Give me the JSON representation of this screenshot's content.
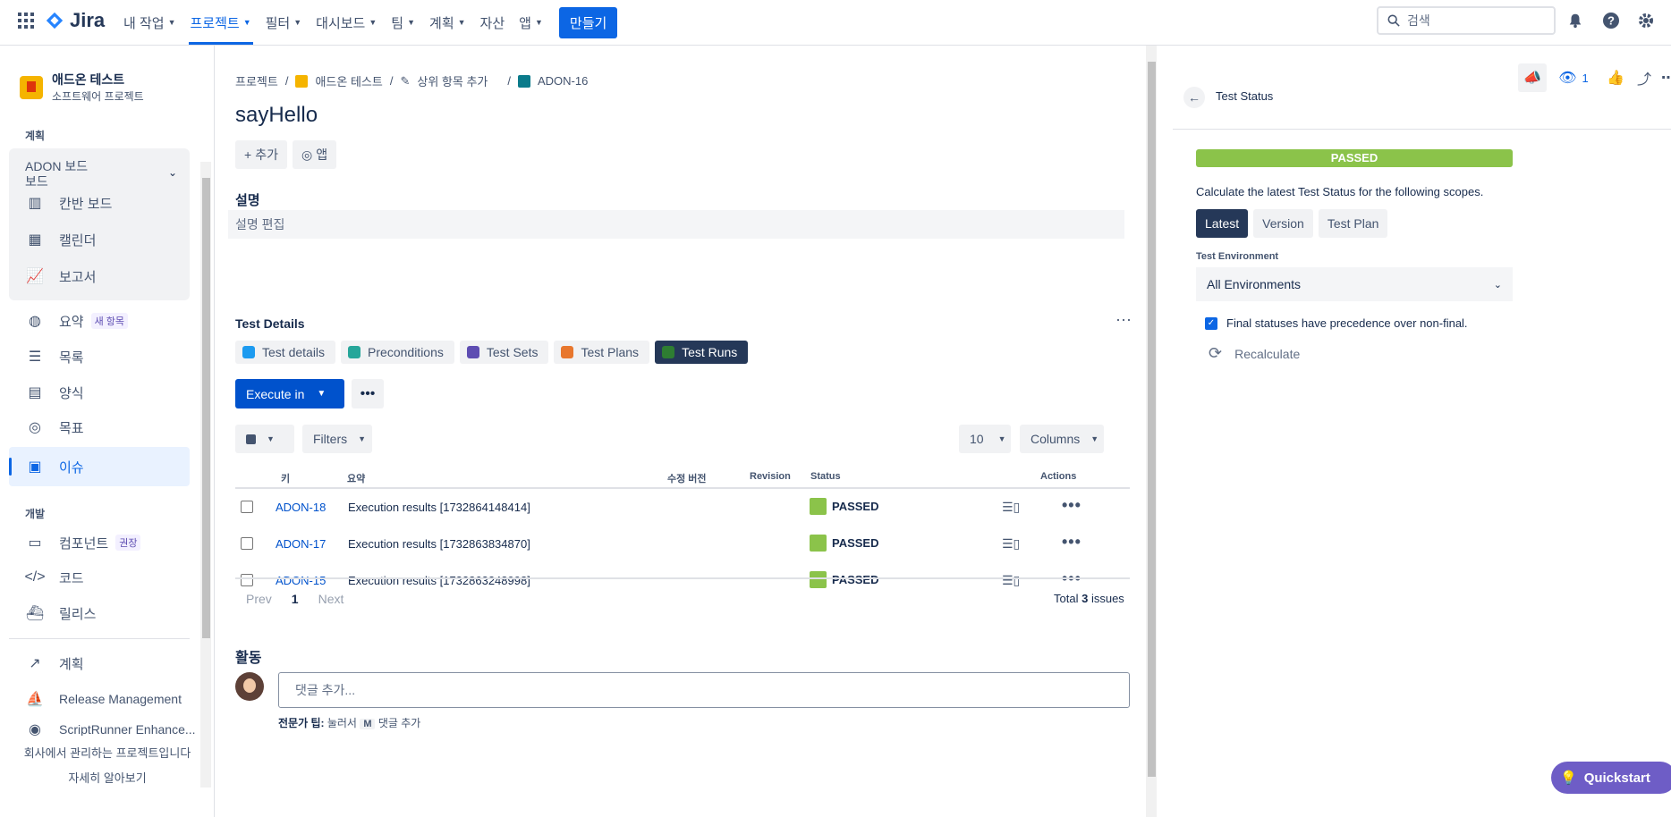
{
  "topnav": {
    "logo": "Jira",
    "items": [
      {
        "label": "내 작업",
        "active": false
      },
      {
        "label": "프로젝트",
        "active": true
      },
      {
        "label": "필터",
        "active": false
      },
      {
        "label": "대시보드",
        "active": false
      },
      {
        "label": "팀",
        "active": false
      },
      {
        "label": "계획",
        "active": false
      },
      {
        "label": "자산",
        "active": false
      },
      {
        "label": "앱",
        "active": false
      }
    ],
    "create": "만들기",
    "search_placeholder": "검색"
  },
  "sidebar": {
    "project_name": "애드온 테스트",
    "project_type": "소프트웨어 프로젝트",
    "section_plan": "계획",
    "board_title": "ADON 보드",
    "board_sub": "보드",
    "board_items": [
      "칸반 보드",
      "캘린더",
      "보고서"
    ],
    "items": [
      {
        "label": "요약",
        "badge": "새 항목"
      },
      {
        "label": "목록"
      },
      {
        "label": "양식"
      },
      {
        "label": "목표"
      },
      {
        "label": "이슈"
      }
    ],
    "section_dev": "개발",
    "dev_items": [
      {
        "label": "컴포넌트",
        "badge": "권장"
      },
      {
        "label": "코드"
      },
      {
        "label": "릴리스"
      }
    ],
    "ext_items": [
      "계획",
      "Release Management",
      "ScriptRunner Enhance..."
    ],
    "footer": "회사에서 관리하는 프로젝트입니다",
    "footer_link": "자세히 알아보기"
  },
  "main": {
    "breadcrumbs": [
      "프로젝트",
      "애드온 테스트",
      "상위 항목 추가",
      "ADON-16"
    ],
    "title": "sayHello",
    "add": "추가",
    "apps": "앱",
    "desc_heading": "설명",
    "desc_placeholder": "설명 편집",
    "td_heading": "Test Details",
    "tabs": [
      "Test details",
      "Preconditions",
      "Test Sets",
      "Test Plans",
      "Test Runs"
    ],
    "execute": "Execute in",
    "filters": "Filters",
    "page_size": "10",
    "columns": "Columns",
    "headers": [
      "키",
      "요약",
      "수정 버전",
      "Revision",
      "Status",
      "Actions"
    ],
    "rows": [
      {
        "key": "ADON-18",
        "summary": "Execution results [1732864148414]",
        "status": "PASSED"
      },
      {
        "key": "ADON-17",
        "summary": "Execution results [1732863834870]",
        "status": "PASSED"
      },
      {
        "key": "ADON-15",
        "summary": "Execution results [1732863248998]",
        "status": "PASSED"
      }
    ],
    "prev": "Prev",
    "page": "1",
    "next": "Next",
    "total_pre": "Total",
    "total_count": "3",
    "total_post": "issues",
    "activity": "활동",
    "comment_placeholder": "댓글 추가...",
    "tip_label": "전문가 팁:",
    "tip_pre": "눌러서",
    "tip_key": "M",
    "tip_post": "댓글 추가"
  },
  "panel": {
    "watch_count": "1",
    "title": "Test Status",
    "status": "PASSED",
    "desc": "Calculate the latest Test Status for the following scopes.",
    "scopes": [
      "Latest",
      "Version",
      "Test Plan"
    ],
    "env_label": "Test Environment",
    "env_value": "All Environments",
    "check_label": "Final statuses have precedence over non-final.",
    "recalc": "Recalculate"
  },
  "quickstart": "Quickstart",
  "colors": {
    "primary": "#0c66e4",
    "passed": "#8bc34a",
    "dark": "#253858"
  }
}
